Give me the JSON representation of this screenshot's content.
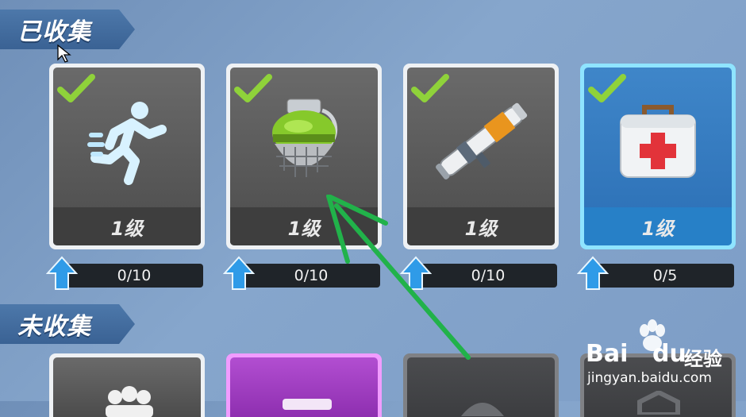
{
  "sections": {
    "collected": "已收集",
    "uncollected": "未收集"
  },
  "cards": [
    {
      "name": "sprint-icon",
      "level": "1级",
      "progress": "0/10",
      "highlight": false
    },
    {
      "name": "grenade-icon",
      "level": "1级",
      "progress": "0/10",
      "highlight": false
    },
    {
      "name": "rocket-launcher-icon",
      "level": "1级",
      "progress": "0/10",
      "highlight": false
    },
    {
      "name": "medkit-icon",
      "level": "1级",
      "progress": "0/5",
      "highlight": true
    }
  ],
  "watermark": {
    "brand": "Bai",
    "brand2": "du",
    "product": "经验",
    "url": "jingyan.baidu.com"
  },
  "colors": {
    "check": "#8fd23a",
    "upgrade_arrow": "#2f9be8",
    "annotation_arrow": "#21b24a"
  }
}
